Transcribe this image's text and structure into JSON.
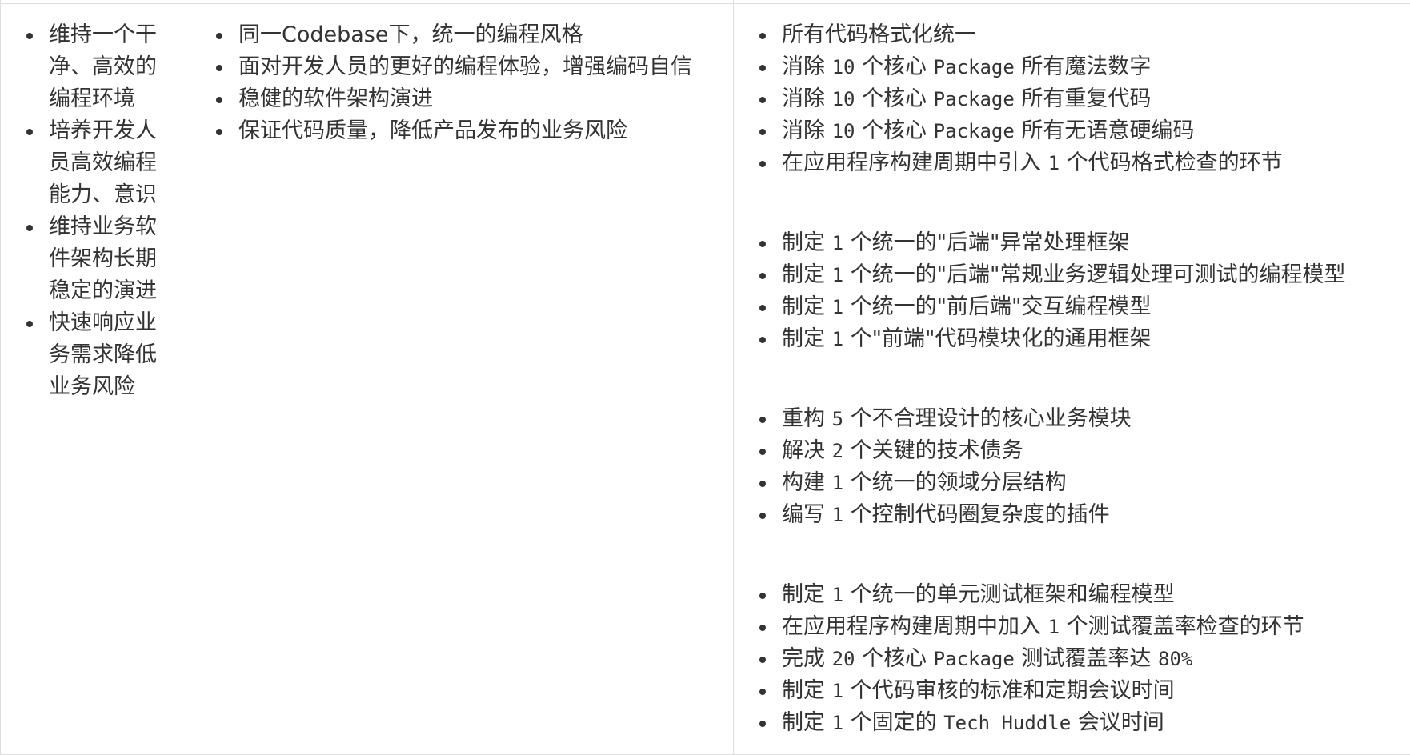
{
  "table": {
    "columns": [
      {
        "items": [
          "维持一个干净、高效的编程环境",
          "培养开发人员高效编程能力、意识",
          "维持业务软件架构长期稳定的演进",
          "快速响应业务需求降低业务风险"
        ]
      },
      {
        "items": [
          "同一Codebase下，统一的编程风格",
          "面对开发人员的更好的编程体验，增强编码自信",
          "稳健的软件架构演进",
          "保证代码质量，降低产品发布的业务风险"
        ]
      },
      {
        "groups": [
          {
            "items": [
              "所有代码格式化统一",
              "消除 10 个核心 Package 所有魔法数字",
              "消除 10 个核心 Package 所有重复代码",
              "消除 10 个核心 Package 所有无语意硬编码",
              "在应用程序构建周期中引入 1 个代码格式检查的环节"
            ]
          },
          {
            "items": [
              "制定 1 个统一的\"后端\"异常处理框架",
              "制定 1 个统一的\"后端\"常规业务逻辑处理可测试的编程模型",
              "制定 1 个统一的\"前后端\"交互编程模型",
              "制定 1 个\"前端\"代码模块化的通用框架"
            ]
          },
          {
            "items": [
              "重构 5 个不合理设计的核心业务模块",
              "解决 2 个关键的技术债务",
              "构建 1 个统一的领域分层结构",
              "编写 1 个控制代码圈复杂度的插件"
            ]
          },
          {
            "items": [
              "制定 1 个统一的单元测试框架和编程模型",
              "在应用程序构建周期中加入 1 个测试覆盖率检查的环节",
              "完成 20 个核心 Package 测试覆盖率达 80%",
              "制定 1 个代码审核的标准和定期会议时间",
              "制定 1 个固定的 Tech Huddle 会议时间"
            ]
          }
        ]
      }
    ]
  }
}
